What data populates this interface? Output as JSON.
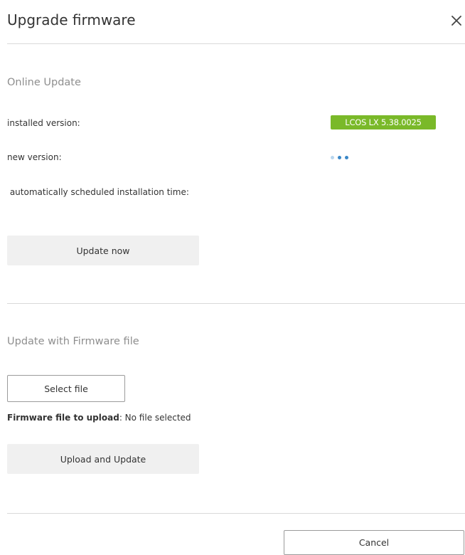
{
  "dialog": {
    "title": "Upgrade firmware",
    "close_icon": "close-icon"
  },
  "online_update": {
    "section_title": "Online Update",
    "installed_version_label": "installed version:",
    "installed_version_value": "LCOS LX 5.38.0025",
    "new_version_label": "new version:",
    "new_version_status_icon": "loading-dots-icon",
    "scheduled_time_label": " automatically scheduled installation time:",
    "update_now_button": "Update now"
  },
  "file_update": {
    "section_title": "Update with Firmware file",
    "select_file_button": "Select file",
    "file_label": "Firmware file to upload",
    "file_value": ": No file selected",
    "upload_button": "Upload and Update"
  },
  "footer": {
    "cancel_button": "Cancel"
  },
  "colors": {
    "badge_green": "#7ab929",
    "loader_light": "#b8d6ee",
    "loader_dark": "#3a87c7",
    "divider": "#d9d9d9"
  }
}
